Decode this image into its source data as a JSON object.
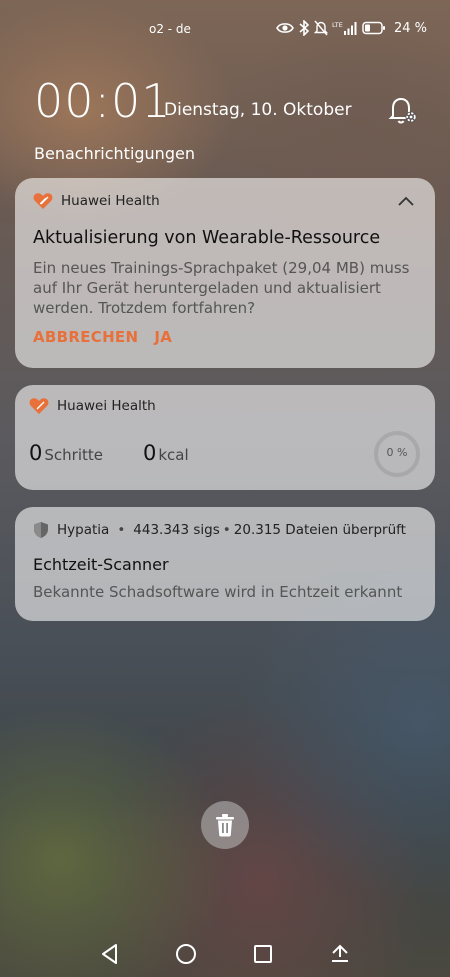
{
  "status_bar": {
    "carrier": "o2 - de",
    "battery_percent": "24 %",
    "icons": [
      "eye-icon",
      "bluetooth-icon",
      "mute-icon",
      "lte-signal-icon",
      "battery-icon"
    ]
  },
  "lockscreen": {
    "time": "00:01",
    "date": "Dienstag, 10. Oktober",
    "section_title": "Benachrichtigungen"
  },
  "notifications": [
    {
      "app": "Huawei Health",
      "title": "Aktualisierung von Wearable-Ressource",
      "body": "Ein neues Trainings-Sprachpaket (29,04 MB) muss auf Ihr Gerät heruntergeladen und aktualisiert werden. Trotzdem fortfahren?",
      "actions": [
        "ABBRECHEN",
        "JA"
      ]
    },
    {
      "app": "Huawei Health",
      "steps_value": "0",
      "steps_label": "Schritte",
      "kcal_value": "0",
      "kcal_label": "kcal",
      "progress_label": "0 %",
      "progress_fraction": 0
    },
    {
      "app": "Hypatia",
      "meta_sigs": "443.343 sigs",
      "meta_files": "20.315 Dateien überprüft",
      "separator": "•",
      "title": "Echtzeit-Scanner",
      "body": "Bekannte Schadsoftware wird in Echtzeit erkannt"
    }
  ],
  "colors": {
    "accent": "#e8703a",
    "card_bg": "rgba(255,255,255,0.58)"
  }
}
